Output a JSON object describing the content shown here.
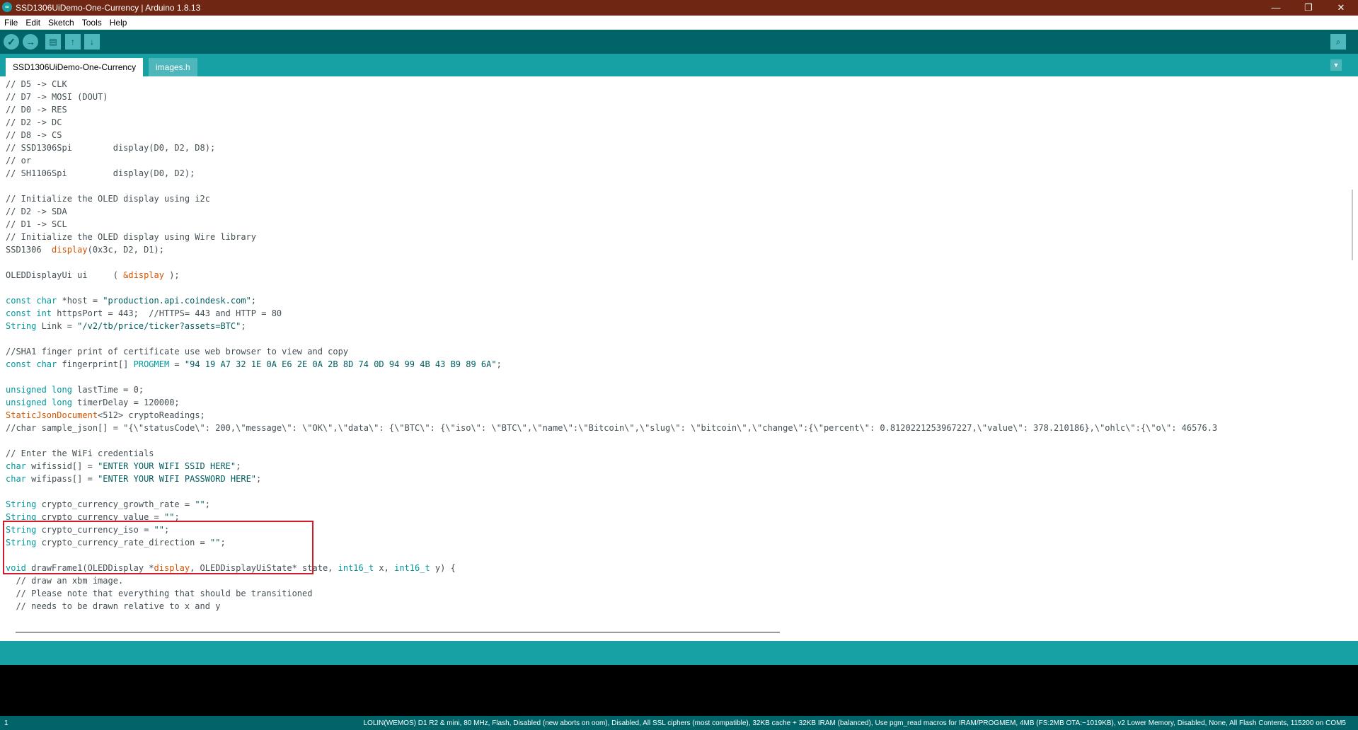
{
  "window": {
    "title": "SSD1306UiDemo-One-Currency | Arduino 1.8.13",
    "logo": "∞"
  },
  "menu": [
    "File",
    "Edit",
    "Sketch",
    "Tools",
    "Help"
  ],
  "toolbar": {
    "verify_icon": "✓",
    "upload_icon": "→",
    "new_icon": "▤",
    "open_icon": "↑",
    "save_icon": "↓",
    "serial_icon": "⌕"
  },
  "tabs": [
    "SSD1306UiDemo-One-Currency",
    "images.h"
  ],
  "tab_menu_icon": "▼",
  "code": [
    [
      {
        "t": "// D5 -> CLK",
        "c": ""
      }
    ],
    [
      {
        "t": "// D7 -> MOSI (DOUT)",
        "c": ""
      }
    ],
    [
      {
        "t": "// D0 -> RES",
        "c": ""
      }
    ],
    [
      {
        "t": "// D2 -> DC",
        "c": ""
      }
    ],
    [
      {
        "t": "// D8 -> CS",
        "c": ""
      }
    ],
    [
      {
        "t": "// SSD1306Spi        display(D0, D2, D8);",
        "c": ""
      }
    ],
    [
      {
        "t": "// or",
        "c": ""
      }
    ],
    [
      {
        "t": "// SH1106Spi         display(D0, D2);",
        "c": ""
      }
    ],
    [],
    [
      {
        "t": "// Initialize the OLED display using i2c",
        "c": ""
      }
    ],
    [
      {
        "t": "// D2 -> SDA",
        "c": ""
      }
    ],
    [
      {
        "t": "// D1 -> SCL",
        "c": ""
      }
    ],
    [
      {
        "t": "// Initialize the OLED display using Wire library",
        "c": ""
      }
    ],
    [
      {
        "t": "SSD1306  ",
        "c": ""
      },
      {
        "t": "display",
        "c": "fn"
      },
      {
        "t": "(0x3c, D2, D1);",
        "c": ""
      }
    ],
    [],
    [
      {
        "t": "OLEDDisplayUi ui     ( ",
        "c": ""
      },
      {
        "t": "&display",
        "c": "fn"
      },
      {
        "t": " );",
        "c": ""
      }
    ],
    [],
    [
      {
        "t": "const char",
        "c": "kw"
      },
      {
        "t": " *host = ",
        "c": ""
      },
      {
        "t": "\"production.api.coindesk.com\"",
        "c": "str"
      },
      {
        "t": ";",
        "c": ""
      }
    ],
    [
      {
        "t": "const int",
        "c": "kw"
      },
      {
        "t": " httpsPort = 443;  //HTTPS= 443 and HTTP = 80",
        "c": ""
      }
    ],
    [
      {
        "t": "String",
        "c": "kw"
      },
      {
        "t": " Link = ",
        "c": ""
      },
      {
        "t": "\"/v2/tb/price/ticker?assets=BTC\"",
        "c": "str"
      },
      {
        "t": ";",
        "c": ""
      }
    ],
    [],
    [
      {
        "t": "//SHA1 finger print of certificate use web browser to view and copy",
        "c": ""
      }
    ],
    [
      {
        "t": "const char",
        "c": "kw"
      },
      {
        "t": " fingerprint[] ",
        "c": ""
      },
      {
        "t": "PROGMEM",
        "c": "kw"
      },
      {
        "t": " = ",
        "c": ""
      },
      {
        "t": "\"94 19 A7 32 1E 0A E6 2E 0A 2B 8D 74 0D 94 99 4B 43 B9 89 6A\"",
        "c": "str"
      },
      {
        "t": ";",
        "c": ""
      }
    ],
    [],
    [
      {
        "t": "unsigned long",
        "c": "kw"
      },
      {
        "t": " lastTime = 0;",
        "c": ""
      }
    ],
    [
      {
        "t": "unsigned long",
        "c": "kw"
      },
      {
        "t": " timerDelay = 120000;",
        "c": ""
      }
    ],
    [
      {
        "t": "StaticJsonDocument",
        "c": "cls"
      },
      {
        "t": "<512> cryptoReadings;",
        "c": ""
      }
    ],
    [
      {
        "t": "//char sample_json[] = \"{\\\"statusCode\\\": 200,\\\"message\\\": \\\"OK\\\",\\\"data\\\": {\\\"BTC\\\": {\\\"iso\\\": \\\"BTC\\\",\\\"name\\\":\\\"Bitcoin\\\",\\\"slug\\\": \\\"bitcoin\\\",\\\"change\\\":{\\\"percent\\\": 0.8120221253967227,\\\"value\\\": 378.210186},\\\"ohlc\\\":{\\\"o\\\": 46576.3",
        "c": ""
      }
    ],
    [],
    [
      {
        "t": "// Enter the WiFi credentials",
        "c": ""
      }
    ],
    [
      {
        "t": "char",
        "c": "kw"
      },
      {
        "t": " wifissid[] = ",
        "c": ""
      },
      {
        "t": "\"ENTER YOUR WIFI SSID HERE\"",
        "c": "str"
      },
      {
        "t": ";",
        "c": ""
      }
    ],
    [
      {
        "t": "char",
        "c": "kw"
      },
      {
        "t": " wifipass[] = ",
        "c": ""
      },
      {
        "t": "\"ENTER YOUR WIFI PASSWORD HERE\"",
        "c": "str"
      },
      {
        "t": ";",
        "c": ""
      }
    ],
    [],
    [
      {
        "t": "String",
        "c": "kw"
      },
      {
        "t": " crypto_currency_growth_rate = ",
        "c": ""
      },
      {
        "t": "\"\"",
        "c": "str"
      },
      {
        "t": ";",
        "c": ""
      }
    ],
    [
      {
        "t": "String",
        "c": "kw"
      },
      {
        "t": " crypto_currency_value = ",
        "c": ""
      },
      {
        "t": "\"\"",
        "c": "str"
      },
      {
        "t": ";",
        "c": ""
      }
    ],
    [
      {
        "t": "String",
        "c": "kw"
      },
      {
        "t": " crypto_currency_iso = ",
        "c": ""
      },
      {
        "t": "\"\"",
        "c": "str"
      },
      {
        "t": ";",
        "c": ""
      }
    ],
    [
      {
        "t": "String",
        "c": "kw"
      },
      {
        "t": " crypto_currency_rate_direction = ",
        "c": ""
      },
      {
        "t": "\"\"",
        "c": "str"
      },
      {
        "t": ";",
        "c": ""
      }
    ],
    [],
    [
      {
        "t": "void",
        "c": "kw"
      },
      {
        "t": " drawFrame1(OLEDDisplay *",
        "c": ""
      },
      {
        "t": "display",
        "c": "fn"
      },
      {
        "t": ", OLEDDisplayUiState* state, ",
        "c": ""
      },
      {
        "t": "int16_t",
        "c": "kw"
      },
      {
        "t": " x, ",
        "c": ""
      },
      {
        "t": "int16_t",
        "c": "kw"
      },
      {
        "t": " y) {",
        "c": ""
      }
    ],
    [
      {
        "t": "  // draw an xbm image.",
        "c": ""
      }
    ],
    [
      {
        "t": "  // Please note that everything that should be transitioned",
        "c": ""
      }
    ],
    [
      {
        "t": "  // needs to be drawn relative to x and y",
        "c": ""
      }
    ]
  ],
  "footer": {
    "line_number": "1",
    "board_info": "LOLIN(WEMOS) D1 R2 & mini, 80 MHz, Flash, Disabled (new aborts on oom), Disabled, All SSL ciphers (most compatible), 32KB cache + 32KB IRAM (balanced), Use pgm_read macros for IRAM/PROGMEM, 4MB (FS:2MB OTA:~1019KB), v2 Lower Memory, Disabled, None, All Flash Contents, 115200 on COM5"
  },
  "window_controls": {
    "minimize": "—",
    "maximize": "❐",
    "close": "✕"
  }
}
